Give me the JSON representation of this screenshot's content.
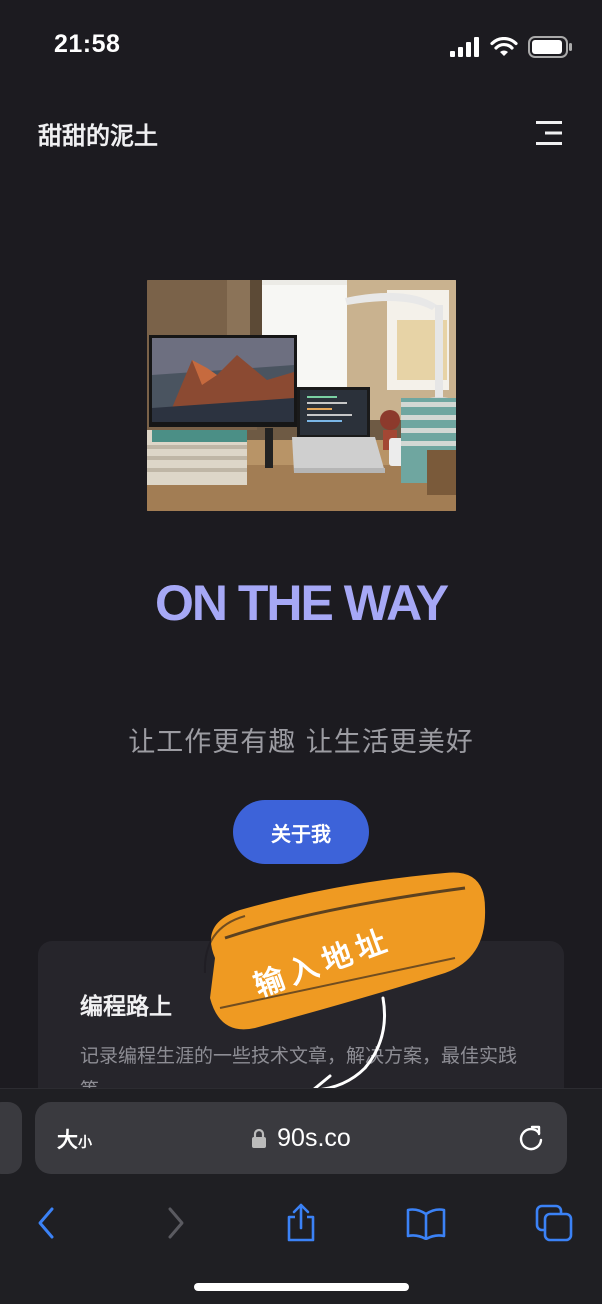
{
  "status": {
    "time": "21:58"
  },
  "site": {
    "title": "甜甜的泥土"
  },
  "hero": {
    "heading": "ON THE WAY",
    "tagline": "让工作更有趣 让生活更美好",
    "button_label": "关于我"
  },
  "card": {
    "title": "编程路上",
    "description": "记录编程生涯的一些技术文章，解决方案，最佳实践等"
  },
  "annotation": {
    "text": "输入地址"
  },
  "browser": {
    "text_size_big": "大",
    "text_size_small": "小",
    "url": "90s.co"
  },
  "colors": {
    "background": "#1c1b20",
    "heading": "#a6a8f6",
    "button": "#3d63d9",
    "annotation": "#ef9a22",
    "toolbar_accent": "#3b82f6"
  },
  "icons": [
    "signal-icon",
    "wifi-icon",
    "battery-icon",
    "menu-icon",
    "lock-icon",
    "reload-icon",
    "back-icon",
    "forward-icon",
    "share-icon",
    "bookmarks-icon",
    "tabs-icon"
  ]
}
